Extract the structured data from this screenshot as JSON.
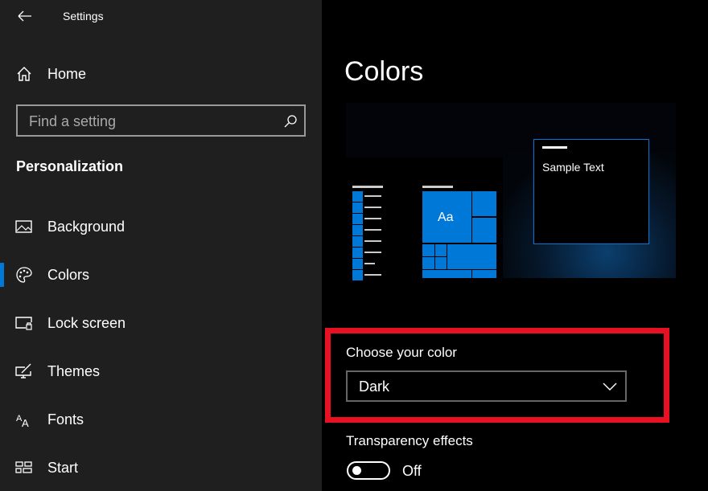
{
  "window": {
    "title": "Settings"
  },
  "sidebar": {
    "home": "Home",
    "search": {
      "placeholder": "Find a setting",
      "value": ""
    },
    "section": "Personalization",
    "items": [
      {
        "label": "Background",
        "icon": "image-icon"
      },
      {
        "label": "Colors",
        "icon": "palette-icon",
        "selected": true
      },
      {
        "label": "Lock screen",
        "icon": "lock-screen-icon"
      },
      {
        "label": "Themes",
        "icon": "themes-icon"
      },
      {
        "label": "Fonts",
        "icon": "fonts-icon"
      },
      {
        "label": "Start",
        "icon": "start-icon"
      }
    ]
  },
  "main": {
    "title": "Colors",
    "preview": {
      "sample_text": "Sample Text",
      "tile_text": "Aa"
    },
    "choose_color": {
      "label": "Choose your color",
      "value": "Dark"
    },
    "transparency": {
      "label": "Transparency effects",
      "state": "Off",
      "on": false
    }
  },
  "colors": {
    "accent": "#0078d7",
    "highlight": "#e81123"
  }
}
